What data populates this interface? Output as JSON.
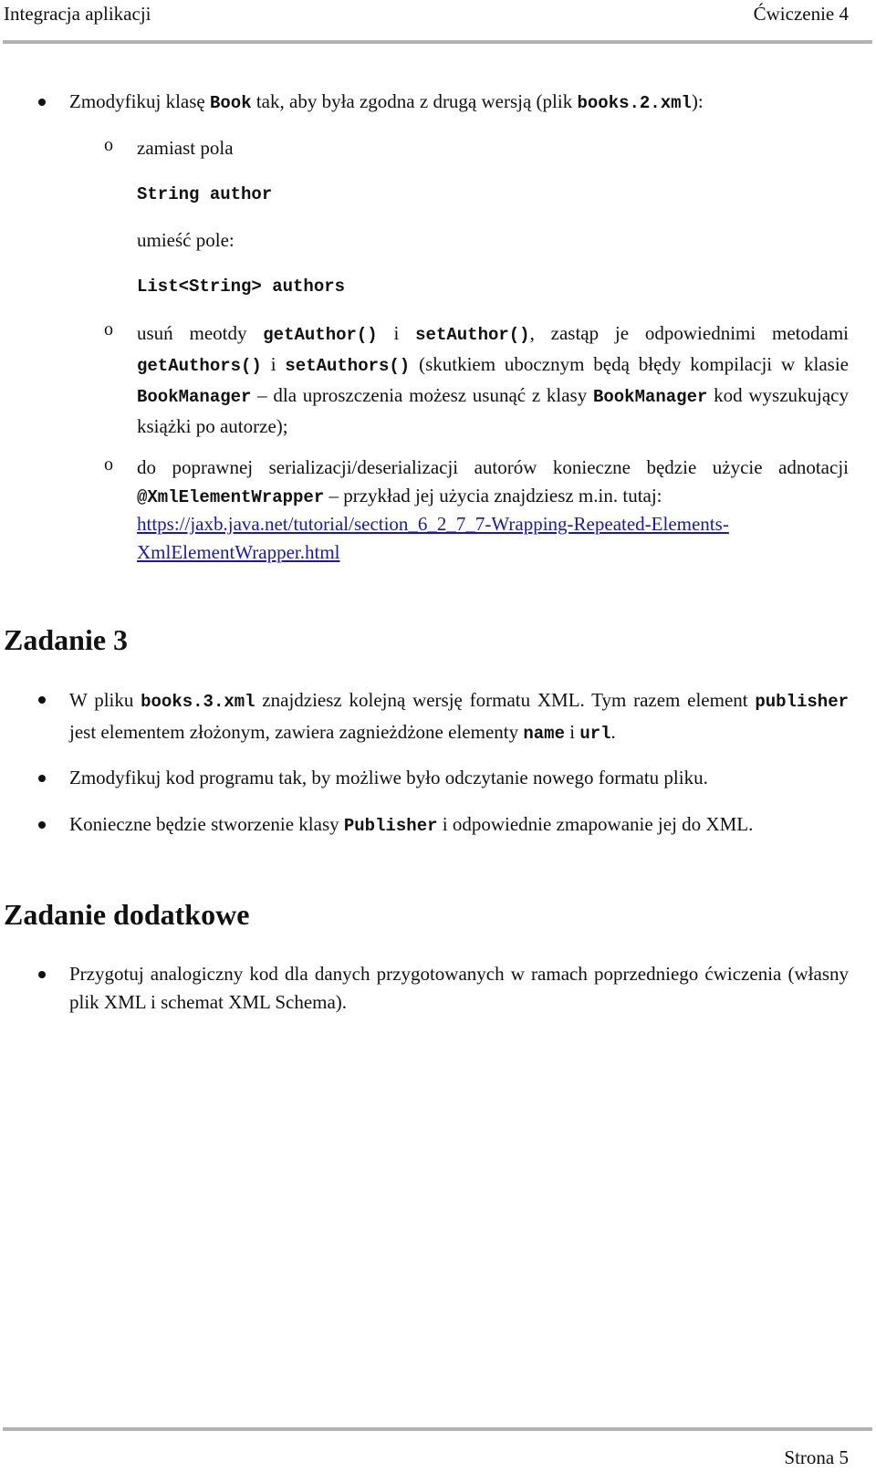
{
  "header": {
    "left": "Integracja aplikacji",
    "right": "Ćwiczenie 4"
  },
  "section2": {
    "bullet": {
      "before": "Zmodyfikuj klasę ",
      "code1": "Book",
      "middle": " tak, aby była zgodna z drugą wersją (plik ",
      "code2": "books.2.xml",
      "after": "):"
    },
    "sub1": {
      "text": "zamiast pola",
      "code1": "String author",
      "text2": "umieść pole:",
      "code2": "List<String> authors"
    },
    "sub2": {
      "t1": "usuń meotdy ",
      "c1": "getAuthor()",
      "t2": " i ",
      "c2": "setAuthor()",
      "t3": ", zastąp je odpowiednimi metodami ",
      "c3": "getAuthors()",
      "t4": " i ",
      "c4": "setAuthors()",
      "t5": " (skutkiem ubocznym będą błędy kompilacji w klasie ",
      "c5": "BookManager",
      "t6": " – dla uproszczenia możesz usunąć z klasy ",
      "c6": "BookManager",
      "t7": " kod wyszukujący książki po autorze);"
    },
    "sub3": {
      "t1": "do poprawnej serializacji/deserializacji autorów konieczne będzie użycie adnotacji ",
      "c1": "@XmlElementWrapper",
      "t2": " – przykład jej użycia znajdziesz m.in. tutaj: ",
      "link": "https://jaxb.java.net/tutorial/section_6_2_7_7-Wrapping-Repeated-Elements-XmlElementWrapper.html",
      "link_line1": "https://jaxb.java.net/tutorial/section_6_2_7_7-Wrapping-Repeated-Elements-",
      "link_line2": "XmlElementWrapper.html"
    }
  },
  "zadanie3": {
    "title": "Zadanie 3",
    "b1": {
      "t1": "W pliku ",
      "c1": "books.3.xml",
      "t2": " znajdziesz kolejną wersję formatu XML. Tym razem element ",
      "c2": "publisher",
      "t3": " jest elementem złożonym, zawiera zagnieżdżone elementy ",
      "c3": "name",
      "t4": " i ",
      "c4": "url",
      "t5": "."
    },
    "b2": "Zmodyfikuj kod programu tak, by możliwe było odczytanie nowego formatu pliku.",
    "b3": {
      "t1": "Konieczne będzie stworzenie klasy ",
      "c1": "Publisher",
      "t2": " i odpowiednie zmapowanie jej do XML."
    }
  },
  "zadanie_dodatkowe": {
    "title": "Zadanie dodatkowe",
    "b1": "Przygotuj analogiczny kod dla danych przygotowanych w ramach poprzedniego ćwiczenia (własny plik XML i schemat XML Schema)."
  },
  "footer": {
    "page": "Strona 5"
  }
}
